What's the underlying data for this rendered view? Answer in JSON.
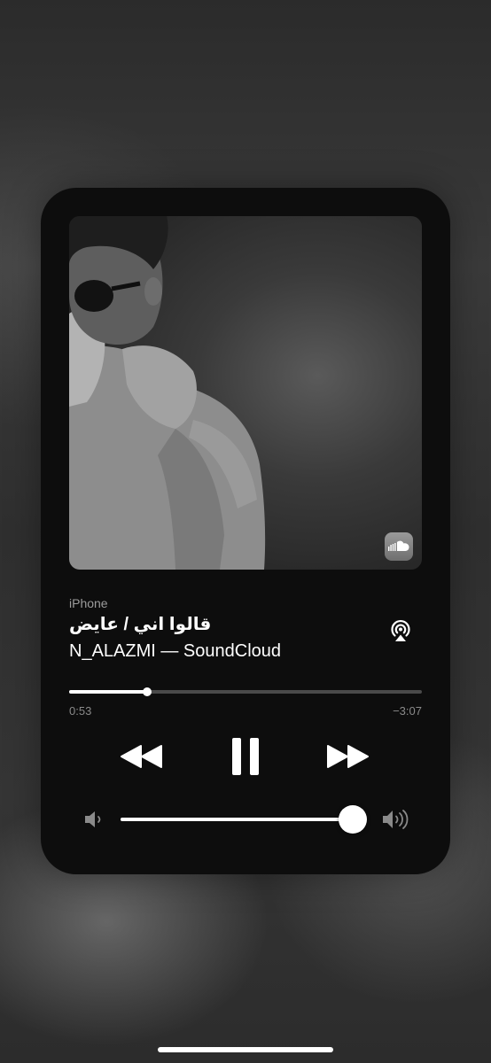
{
  "now_playing": {
    "device_label": "iPhone",
    "title": "قالوا اني / عايض",
    "artist_line": "N_ALAZMI — SoundCloud",
    "source_app_icon": "soundcloud-icon",
    "progress": 0.22,
    "elapsed_time": "0:53",
    "remaining_time": "−3:07",
    "volume": 0.97,
    "is_playing": true
  },
  "controls": {
    "airplay_icon": "airplay-icon",
    "rewind_icon": "rewind-icon",
    "pause_icon": "pause-icon",
    "forward_icon": "fast-forward-icon",
    "volume_low_icon": "speaker-low-icon",
    "volume_high_icon": "speaker-high-icon"
  },
  "colors": {
    "card_background": "#0d0d0d",
    "accent": "#ffffff",
    "secondary_text": "#9c9c9c",
    "track_background": "#4a4a4a"
  }
}
